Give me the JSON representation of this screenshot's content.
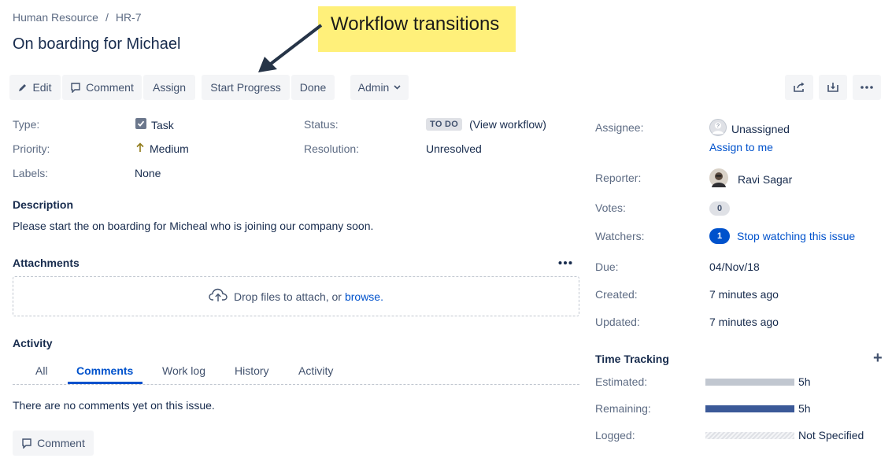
{
  "breadcrumb": {
    "project": "Human Resource",
    "separator": "/",
    "issue_key": "HR-7"
  },
  "issue": {
    "title": "On boarding for Michael"
  },
  "callout": {
    "text": "Workflow transitions"
  },
  "toolbar": {
    "edit": "Edit",
    "comment": "Comment",
    "assign": "Assign",
    "start_progress": "Start Progress",
    "done": "Done",
    "admin": "Admin"
  },
  "details": {
    "type_label": "Type:",
    "type_value": "Task",
    "priority_label": "Priority:",
    "priority_value": "Medium",
    "labels_label": "Labels:",
    "labels_value": "None",
    "status_label": "Status:",
    "status_value": "TO DO",
    "view_workflow": "(View workflow)",
    "resolution_label": "Resolution:",
    "resolution_value": "Unresolved"
  },
  "description": {
    "heading": "Description",
    "text": "Please start the on boarding for Micheal who is joining our company soon."
  },
  "attachments": {
    "heading": "Attachments",
    "drop_text": "Drop files to attach, or",
    "browse": "browse."
  },
  "activity": {
    "heading": "Activity",
    "tabs": [
      "All",
      "Comments",
      "Work log",
      "History",
      "Activity"
    ],
    "active_tab": "Comments",
    "empty_text": "There are no comments yet on this issue.",
    "comment_button": "Comment"
  },
  "people": {
    "assignee_label": "Assignee:",
    "assignee_value": "Unassigned",
    "assign_to_me": "Assign to me",
    "reporter_label": "Reporter:",
    "reporter_value": "Ravi Sagar",
    "votes_label": "Votes:",
    "votes_count": "0",
    "watchers_label": "Watchers:",
    "watchers_count": "1",
    "stop_watching": "Stop watching this issue"
  },
  "dates": {
    "due_label": "Due:",
    "due_value": "04/Nov/18",
    "created_label": "Created:",
    "created_value": "7 minutes ago",
    "updated_label": "Updated:",
    "updated_value": "7 minutes ago"
  },
  "time_tracking": {
    "heading": "Time Tracking",
    "add": "+",
    "estimated_label": "Estimated:",
    "estimated_value": "5h",
    "remaining_label": "Remaining:",
    "remaining_value": "5h",
    "logged_label": "Logged:",
    "logged_value": "Not Specified",
    "estimated_fill": 1.0,
    "remaining_fill": 1.0,
    "logged_fill": 0
  },
  "colors": {
    "link": "#0052cc",
    "callout": "#fff07a",
    "estimated_bar": "#c1c7d0",
    "remaining_bar": "#3b5998",
    "button_bg": "#f4f5f7"
  },
  "icons": {
    "edit": "pencil-icon",
    "comment": "speech-bubble-icon",
    "admin_caret": "chevron-down-icon",
    "share": "share-icon",
    "export": "export-icon",
    "more": "more-icon",
    "task": "checkbox-icon",
    "priority": "arrow-up-icon",
    "upload": "cloud-upload-icon",
    "add": "plus-icon"
  }
}
